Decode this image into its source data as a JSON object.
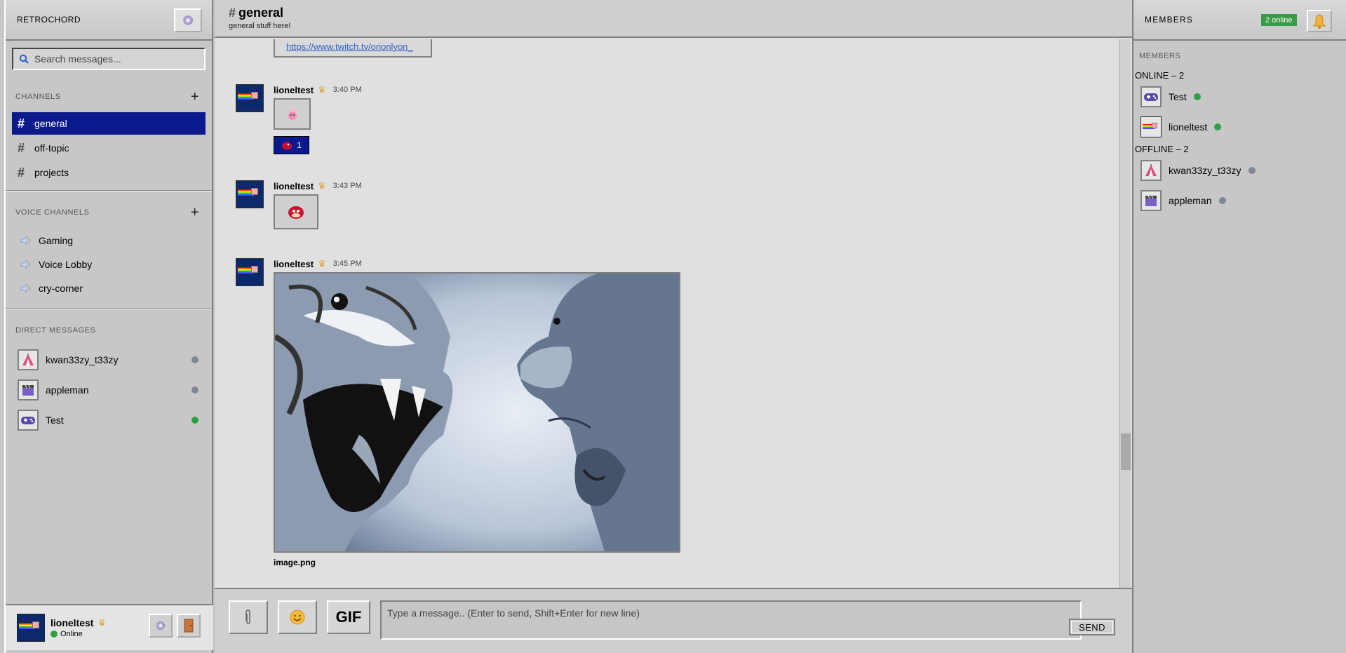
{
  "app": {
    "title": "RETROCHORD"
  },
  "search": {
    "placeholder": "Search messages..."
  },
  "channels": {
    "heading": "CHANNELS",
    "items": [
      {
        "label": "general",
        "active": true
      },
      {
        "label": "off-topic",
        "active": false
      },
      {
        "label": "projects",
        "active": false
      }
    ]
  },
  "voice": {
    "heading": "VOICE CHANNELS",
    "items": [
      {
        "label": "Gaming"
      },
      {
        "label": "Voice Lobby"
      },
      {
        "label": "cry-corner"
      }
    ]
  },
  "dms": {
    "heading": "DIRECT MESSAGES",
    "items": [
      {
        "label": "kwan33zy_t33zy",
        "status": "offline",
        "icon": "tent-icon"
      },
      {
        "label": "appleman",
        "status": "offline",
        "icon": "clapperboard-icon"
      },
      {
        "label": "Test",
        "status": "online",
        "icon": "gamepad-icon"
      }
    ]
  },
  "user": {
    "name": "lioneltest",
    "status": "Online"
  },
  "header": {
    "channel": "general",
    "description": "general stuff here!"
  },
  "messages": {
    "link": "https://www.twitch.tv/orionlyon_",
    "items": [
      {
        "author": "lioneltest",
        "time": "3:40 PM",
        "content": "emoji",
        "icon": "pink-bunny-icon",
        "reaction": {
          "icon": "red-bird-icon",
          "count": "1"
        }
      },
      {
        "author": "lioneltest",
        "time": "3:43 PM",
        "content": "emoji",
        "icon": "red-bird-icon"
      },
      {
        "author": "lioneltest",
        "time": "3:45 PM",
        "content": "image",
        "caption": "image.png",
        "icon": "tiger-vs-chimp-image"
      }
    ]
  },
  "composer": {
    "placeholder": "Type a message.. (Enter to send, Shift+Enter for new line)",
    "gif_label": "GIF",
    "send_label": "SEND"
  },
  "members": {
    "title": "MEMBERS",
    "badge": "2 online",
    "subheading": "MEMBERS",
    "online_heading": "ONLINE – 2",
    "offline_heading": "OFFLINE – 2",
    "online": [
      {
        "label": "Test",
        "icon": "gamepad-icon"
      },
      {
        "label": "lioneltest",
        "icon": "nyan-cat-avatar"
      }
    ],
    "offline": [
      {
        "label": "kwan33zy_t33zy",
        "icon": "tent-icon"
      },
      {
        "label": "appleman",
        "icon": "clapperboard-icon"
      }
    ]
  },
  "colors": {
    "active_channel": "#0a1a8c",
    "online": "#2ea043",
    "offline": "#7e8795",
    "badge": "#3b9a48",
    "link": "#2f5ec9"
  }
}
